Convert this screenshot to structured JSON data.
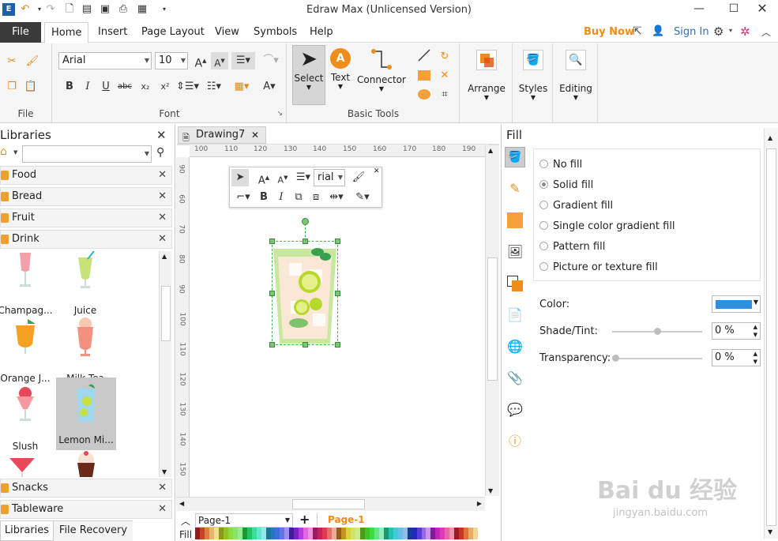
{
  "app": {
    "title": "Edraw Max (Unlicensed Version)"
  },
  "tabs": [
    {
      "label": "File"
    },
    {
      "label": "Home"
    },
    {
      "label": "Insert"
    },
    {
      "label": "Page Layout"
    },
    {
      "label": "View"
    },
    {
      "label": "Symbols"
    },
    {
      "label": "Help"
    }
  ],
  "header_links": {
    "buy_now": "Buy Now",
    "sign_in": "Sign In"
  },
  "ribbon": {
    "file_group": "File",
    "font": {
      "family": "Arial",
      "size": "10",
      "group_label": "Font"
    },
    "basic_tools": {
      "select": "Select",
      "text": "Text",
      "connector": "Connector",
      "group_label": "Basic Tools"
    },
    "arrange": "Arrange",
    "styles": "Styles",
    "editing": "Editing"
  },
  "libraries": {
    "title": "Libraries",
    "categories_top": [
      "Food",
      "Bread",
      "Fruit",
      "Drink"
    ],
    "shapes": [
      {
        "label": "Champag..."
      },
      {
        "label": "Juice"
      },
      {
        "label": "Orange J..."
      },
      {
        "label": "Milk Tea"
      },
      {
        "label": "Slush"
      },
      {
        "label": "Lemon Mi..."
      }
    ],
    "categories_bottom": [
      "Snacks",
      "Tableware"
    ],
    "bottom_tabs": [
      "Libraries",
      "File Recovery"
    ]
  },
  "document": {
    "tab": "Drawing7",
    "ruler_h": [
      "100",
      "110",
      "120",
      "130",
      "140",
      "150",
      "160",
      "170",
      "180",
      "190"
    ],
    "ruler_v": [
      "90",
      "60",
      "70",
      "80",
      "90",
      "100",
      "110",
      "120",
      "130",
      "140",
      "150"
    ],
    "mini_font": "rial"
  },
  "pages": {
    "selector": "Page-1",
    "active": "Page-1"
  },
  "fill_label": "Fill",
  "fill_panel": {
    "title": "Fill",
    "options": [
      {
        "label": "No fill",
        "selected": false
      },
      {
        "label": "Solid fill",
        "selected": true
      },
      {
        "label": "Gradient fill",
        "selected": false
      },
      {
        "label": "Single color gradient fill",
        "selected": false
      },
      {
        "label": "Pattern fill",
        "selected": false
      },
      {
        "label": "Picture or texture fill",
        "selected": false
      }
    ],
    "color_label": "Color:",
    "color_value": "#2e8fe0",
    "shade_label": "Shade/Tint:",
    "shade_value": "0 %",
    "shade_level": 0.5,
    "transparency_label": "Transparency:",
    "transparency_value": "0 %",
    "transparency_level": 0
  },
  "colors": {
    "accent": "#f08c1a",
    "link": "#2a6fc9"
  }
}
